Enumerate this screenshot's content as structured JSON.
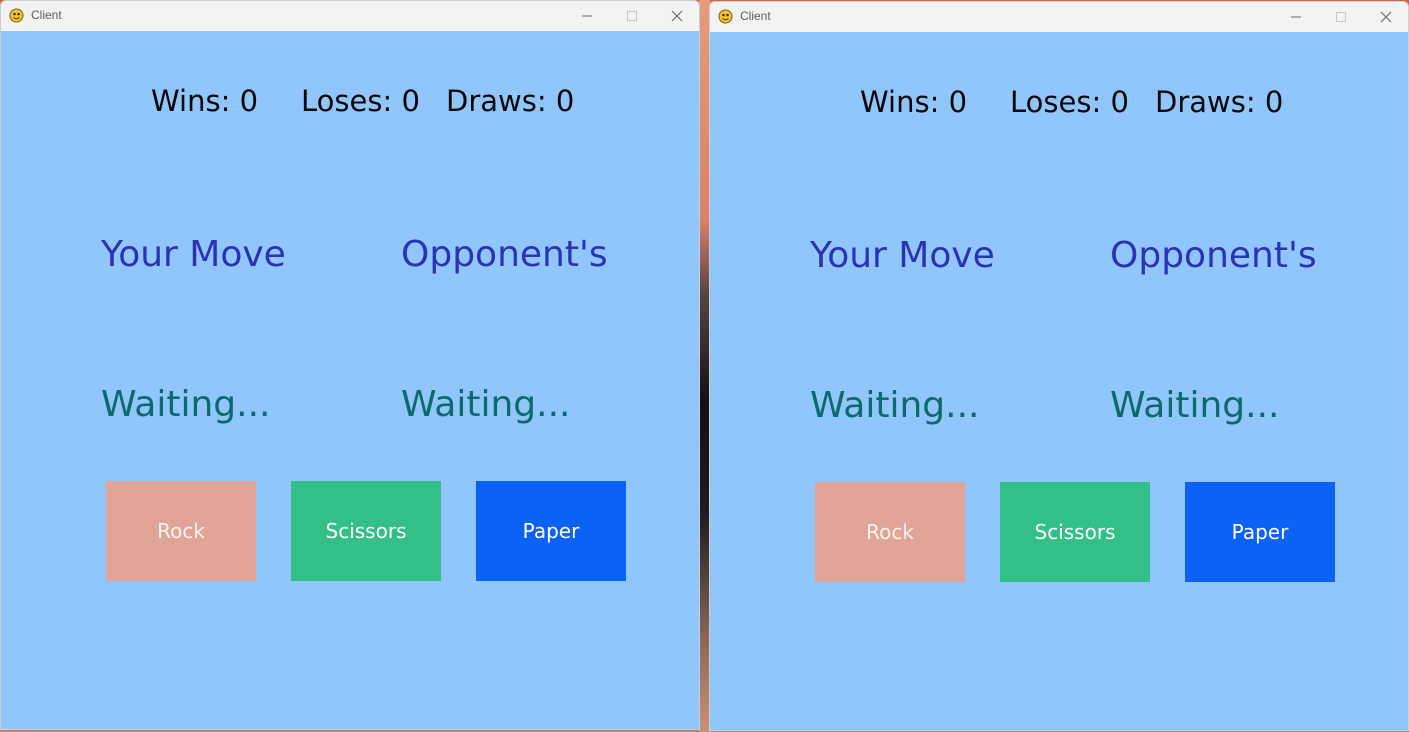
{
  "windows": [
    {
      "title": "Client",
      "score": {
        "wins_label": "Wins: 0",
        "loses_label": "Loses: 0",
        "draws_label": "Draws: 0"
      },
      "your_move_label": "Your Move",
      "opponent_label": "Opponent's",
      "your_status": "Waiting...",
      "opponent_status": "Waiting...",
      "buttons": {
        "rock": "Rock",
        "scissors": "Scissors",
        "paper": "Paper"
      }
    },
    {
      "title": "Client",
      "score": {
        "wins_label": "Wins: 0",
        "loses_label": "Loses: 0",
        "draws_label": "Draws: 0"
      },
      "your_move_label": "Your Move",
      "opponent_label": "Opponent's",
      "your_status": "Waiting...",
      "opponent_status": "Waiting...",
      "buttons": {
        "rock": "Rock",
        "scissors": "Scissors",
        "paper": "Paper"
      }
    }
  ],
  "colors": {
    "client_background": "#90c5fe",
    "heading": "#2a34b3",
    "status": "#0d6a6a",
    "rock_button": "#e0a498",
    "scissors_button": "#32bf88",
    "paper_button": "#0a63f6"
  },
  "icons": {
    "app_icon": "pygame-snake-icon",
    "minimize": "minimize-icon",
    "maximize": "maximize-icon",
    "close": "close-icon"
  }
}
